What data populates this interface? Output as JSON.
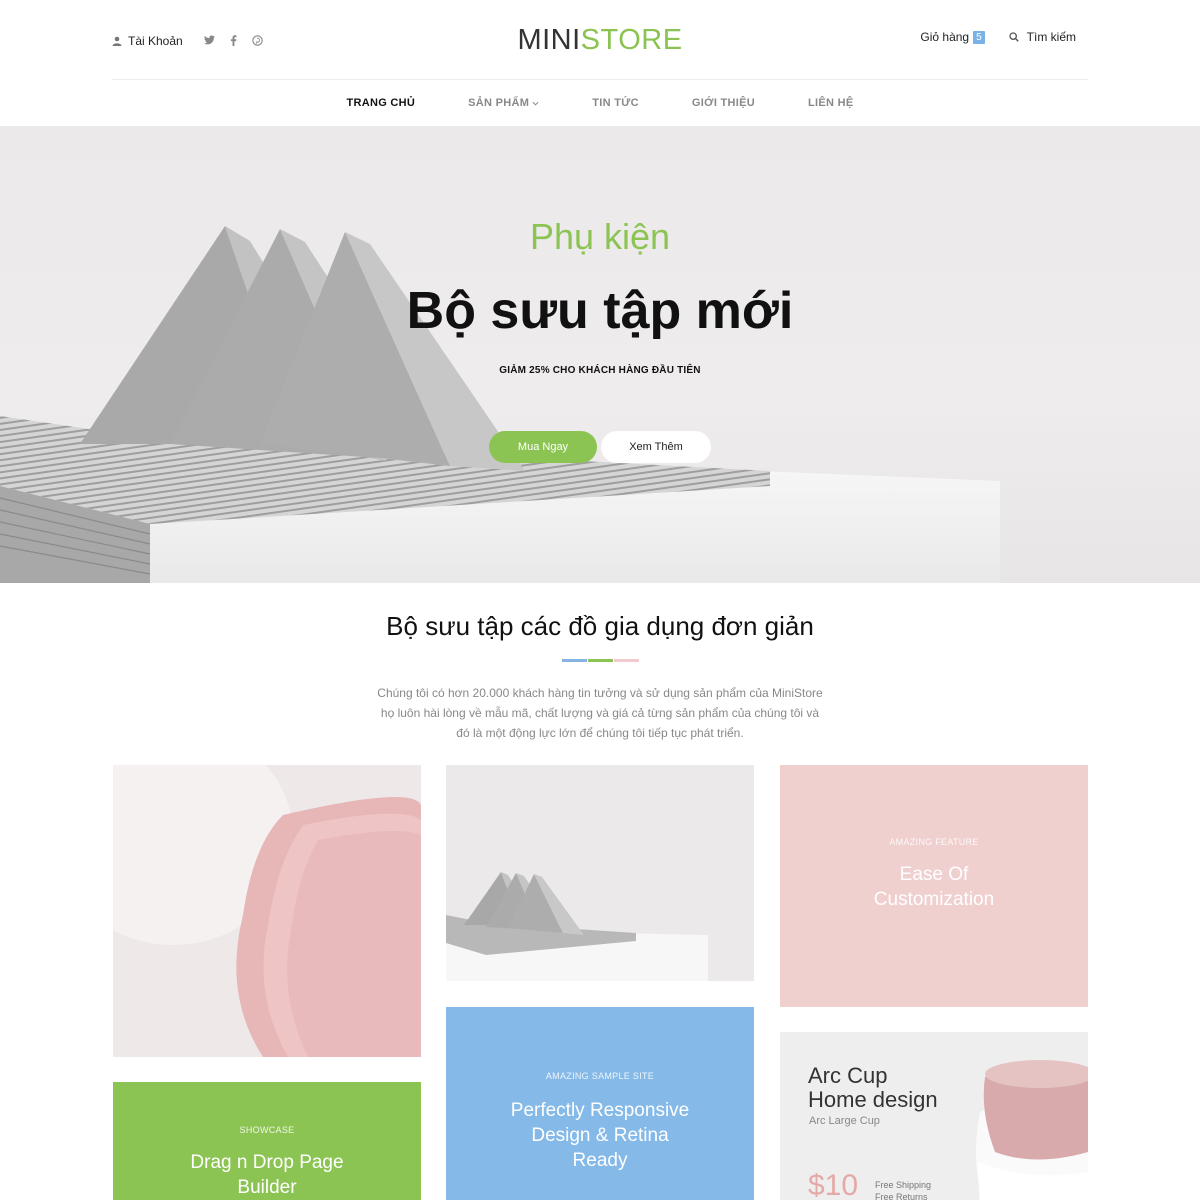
{
  "header": {
    "account_label": "Tài Khoản",
    "logo_mini": "MINI",
    "logo_store": "STORE",
    "cart_label": "Giỏ hàng",
    "cart_count": "5",
    "search_label": "Tìm kiếm",
    "social_icons": [
      "twitter-icon",
      "facebook-icon",
      "pinterest-icon"
    ]
  },
  "nav": {
    "items": [
      {
        "label": "TRANG CHỦ"
      },
      {
        "label": "SẢN PHẨM"
      },
      {
        "label": "TIN TỨC"
      },
      {
        "label": "GIỚI THIỆU"
      },
      {
        "label": "LIÊN HỆ"
      }
    ]
  },
  "hero": {
    "subtitle": "Phụ kiện",
    "title": "Bộ sưu tập mới",
    "promo": "GIẢM 25% CHO KHÁCH HÀNG ĐẦU TIÊN",
    "primary_button": "Mua Ngay",
    "secondary_button": "Xem Thêm"
  },
  "intro": {
    "title": "Bộ sưu tập các đồ gia dụng đơn giản",
    "line1": "Chúng tôi có hơn 20.000 khách hàng tin tưởng và sử dụng sản phẩm của MiniStore",
    "line2": "họ luôn hài lòng về mẫu mã, chất lượng và giá cả từng sản phẩm của chúng tôi và",
    "line3": "đó là một động lực lớn để chúng tôi tiếp tục phát triển."
  },
  "grid": {
    "showcase": {
      "label": "SHOWCASE",
      "title_line1": "Drag n Drop Page",
      "title_line2": "Builder"
    },
    "responsive": {
      "label": "AMAZING SAMPLE SITE",
      "title_line1": "Perfectly Responsive",
      "title_line2": "Design & Retina",
      "title_line3": "Ready"
    },
    "feature": {
      "label": "AMAZING FEATURE",
      "title_line1": "Ease Of",
      "title_line2": "Customization"
    },
    "product": {
      "title_line1": "Arc Cup",
      "title_line2": "Home design",
      "subtitle": "Arc Large Cup",
      "price": "$10",
      "note1": "Free Shipping",
      "note2": "Free Returns"
    }
  },
  "colors": {
    "accent_green": "#8cc454",
    "accent_blue": "#85b9e8",
    "accent_pink": "#f0cfcf",
    "underline": [
      "#85b3e3",
      "#8cc454",
      "#f2c9cc"
    ]
  }
}
